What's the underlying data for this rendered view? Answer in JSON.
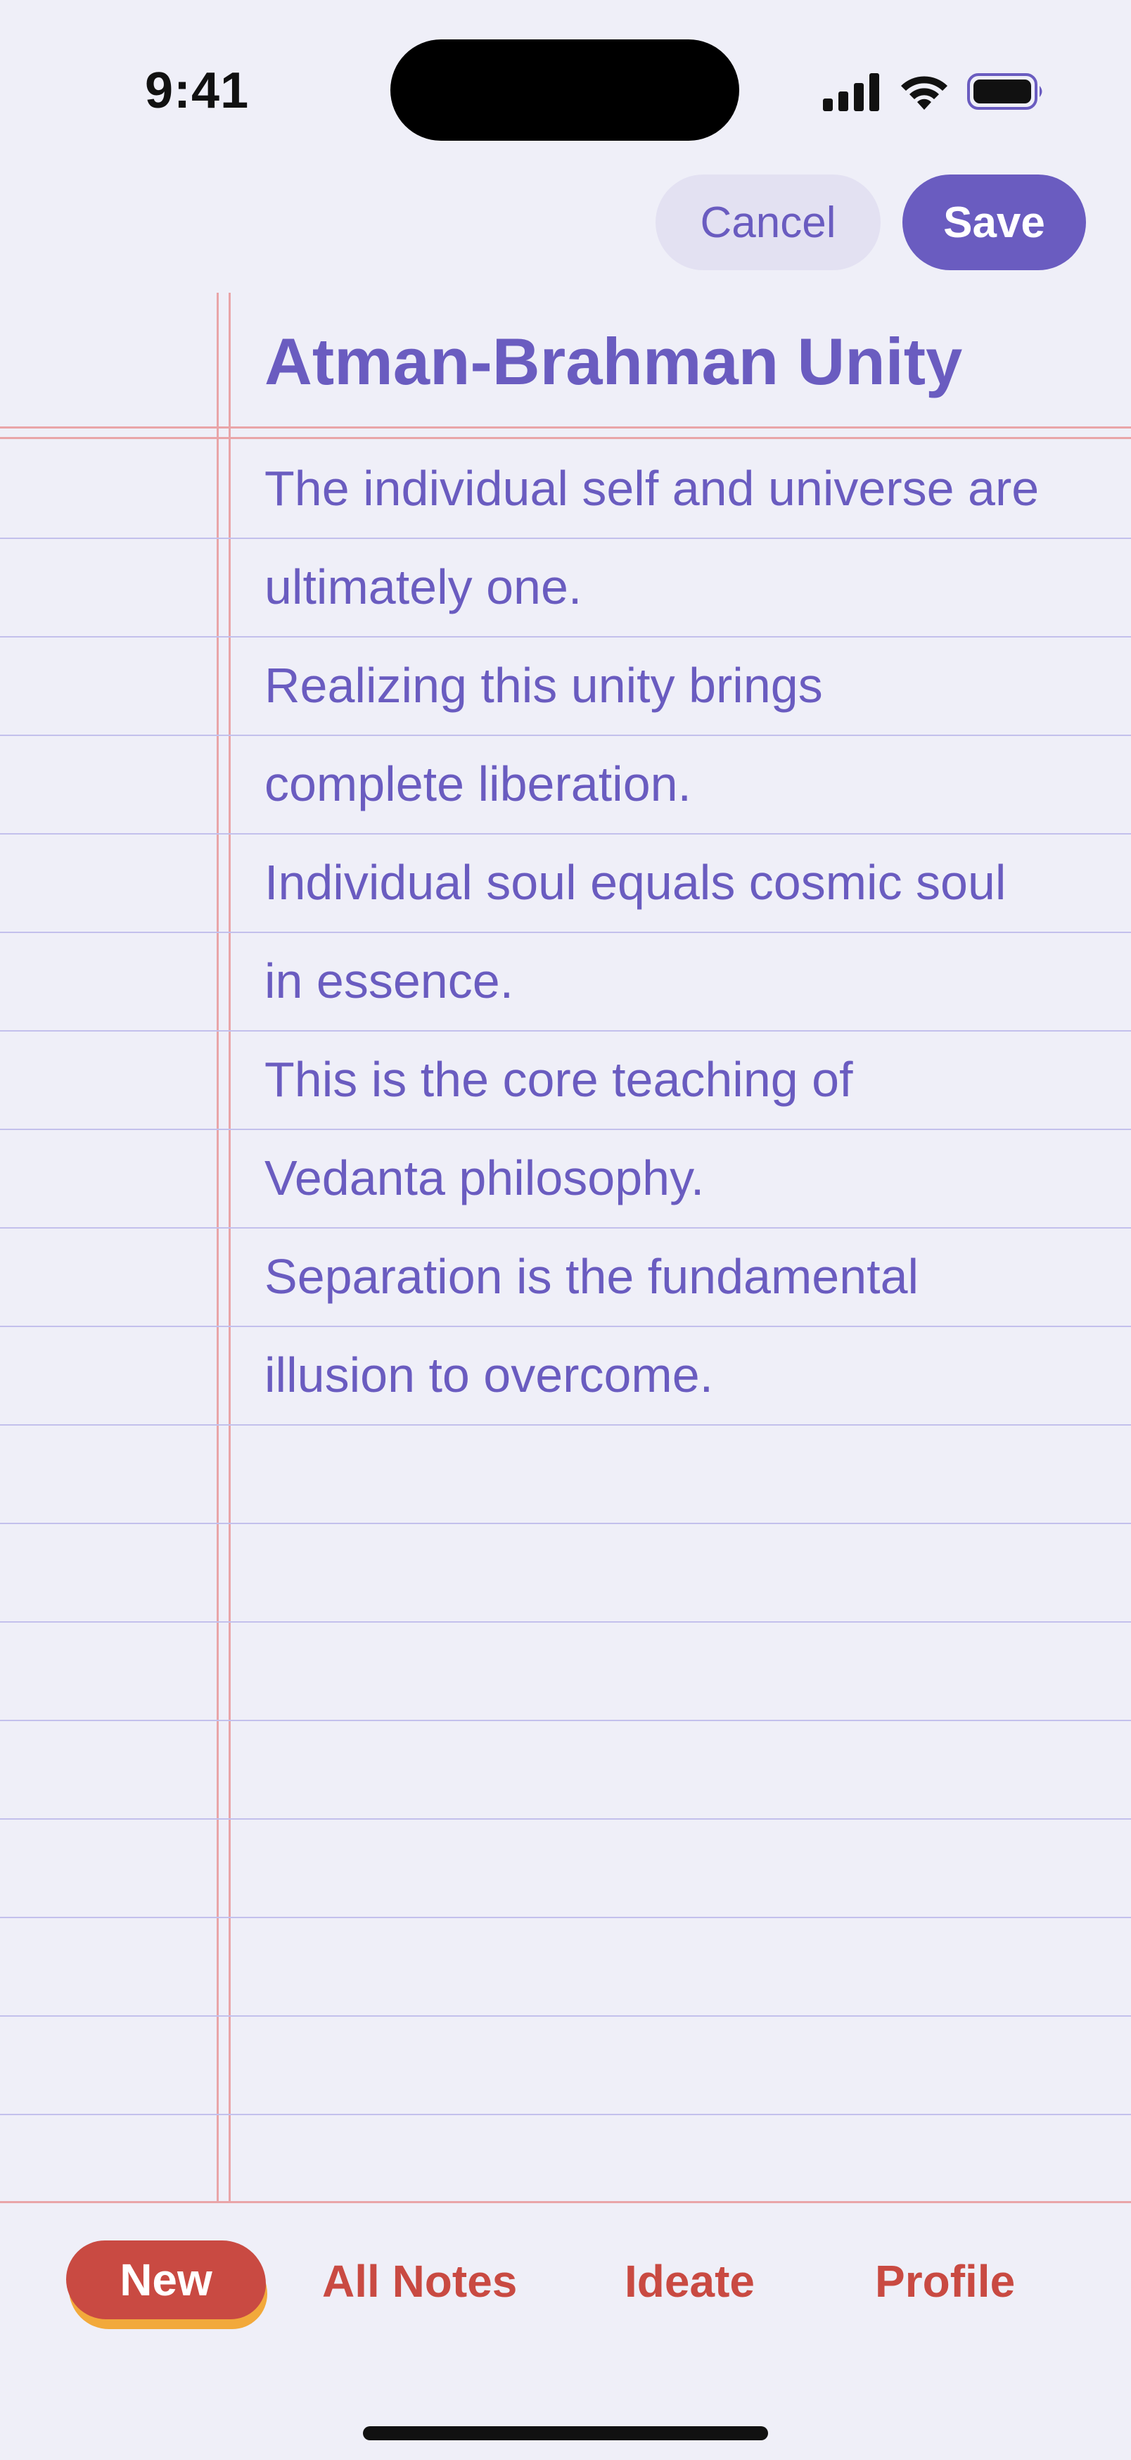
{
  "status_bar": {
    "time": "9:41"
  },
  "header": {
    "cancel_label": "Cancel",
    "save_label": "Save"
  },
  "note": {
    "title": "Atman-Brahman Unity",
    "lines": [
      "The individual self and universe are",
      "ultimately one.",
      "Realizing this unity brings",
      "complete liberation.",
      "Individual soul equals cosmic soul",
      "in essence.",
      "This is the core teaching of",
      "Vedanta philosophy.",
      "Separation is the fundamental",
      "illusion to overcome."
    ]
  },
  "tabbar": {
    "tabs": [
      {
        "label": "New",
        "active": true
      },
      {
        "label": "All Notes"
      },
      {
        "label": "Ideate"
      },
      {
        "label": "Profile"
      }
    ]
  },
  "colors": {
    "accent": "#6a5cc0",
    "tab_red": "#c94a42",
    "background": "#efeff8",
    "margin_red": "#e9a5a8",
    "rule_blue": "#c3c0ec"
  }
}
